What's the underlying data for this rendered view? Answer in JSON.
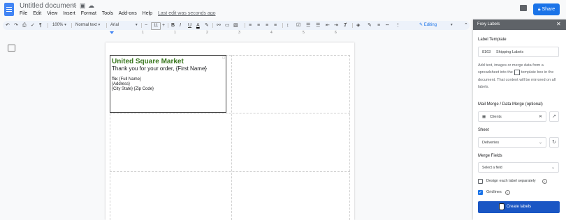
{
  "header": {
    "doc_title": "Untitled document",
    "menu": [
      "File",
      "Edit",
      "View",
      "Insert",
      "Format",
      "Tools",
      "Add-ons",
      "Help"
    ],
    "last_edit": "Last edit was seconds ago",
    "share_label": "Share",
    "title_icons": [
      "star-icon",
      "folder-icon",
      "cloud-icon"
    ]
  },
  "toolbar": {
    "zoom": "100%",
    "style": "Normal text",
    "font": "Arial",
    "font_size": "11",
    "mode": "Editing",
    "bold": "B",
    "italic": "I",
    "underline": "U",
    "text_color": "A"
  },
  "ruler": {
    "ticks": [
      "1",
      "1",
      "2",
      "3",
      "4",
      "5",
      "6",
      "7"
    ]
  },
  "document": {
    "label": {
      "title": "United Square Market",
      "thanks": "Thank you for your order, {First Name}",
      "to_prefix": "To:",
      "to_value": "{Full Name}",
      "address": "{Address}",
      "city_line": "{City State} {Zip Code}"
    },
    "colors": {
      "label_title": "#38761d"
    }
  },
  "sidebar": {
    "title": "Foxy Labels",
    "template_label": "Label Template",
    "template_code": "8163",
    "template_name": "Shipping Labels",
    "help_part1": "Add text, images or merge data from a spreadsheet into the",
    "help_part2": "template box in the document. That content will be mirrored on all labels.",
    "merge_label": "Mail Merge / Data Merge (optional)",
    "merge_value": "Clients",
    "sheet_label": "Sheet",
    "sheet_value": "Deliveries",
    "fields_label": "Merge Fields",
    "fields_placeholder": "Select a field",
    "design_separately": "Design each label separately",
    "gridlines": "Gridlines",
    "gridlines_checked": true,
    "create_button": "Create labels",
    "accent": "#1a56c4"
  }
}
